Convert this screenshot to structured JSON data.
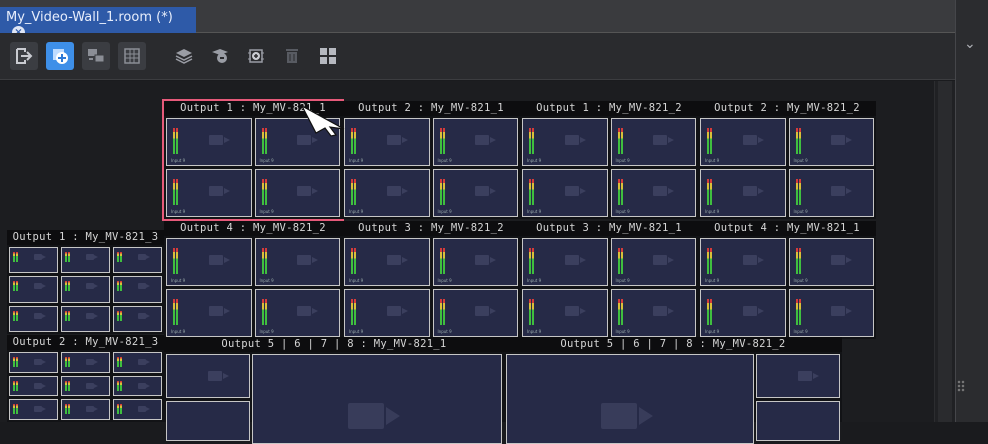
{
  "tab": {
    "title": "My_Video-Wall_1.room (*)",
    "close_glyph": "×"
  },
  "toolbar": {
    "icons": [
      "exit-icon",
      "add-layer-icon",
      "dual-screen-icon",
      "grid-icon",
      "layers-icon",
      "media-icon",
      "add-monitor-icon",
      "trash-icon",
      "tiles-icon"
    ]
  },
  "right_panel": {
    "collapse_glyph": "⌄"
  },
  "colors": {
    "accent": "#2e5aa8",
    "selection": "#e65a7a",
    "cell_bg": "#262a47",
    "meter_green": "#3fbf3f",
    "meter_yellow": "#d9c03a",
    "meter_red": "#d43b3b"
  },
  "cell_label": "Input 9",
  "outputs": [
    {
      "id": "o1",
      "title": "Output 1 : My_MV-821_1"
    },
    {
      "id": "o2",
      "title": "Output 2 : My_MV-821_1"
    },
    {
      "id": "o3",
      "title": "Output 1 : My_MV-821_2"
    },
    {
      "id": "o4",
      "title": "Output 2 : My_MV-821_2"
    },
    {
      "id": "o5",
      "title": "Output 4 : My_MV-821_2"
    },
    {
      "id": "o6",
      "title": "Output 3 : My_MV-821_2"
    },
    {
      "id": "o7",
      "title": "Output 3 : My_MV-821_1"
    },
    {
      "id": "o8",
      "title": "Output 4 : My_MV-821_1"
    },
    {
      "id": "o9",
      "title": "Output 1 : My_MV-821_3"
    },
    {
      "id": "o10",
      "title": "Output 2 : My_MV-821_3"
    },
    {
      "id": "o11",
      "title": "Output 5 | 6 | 7 | 8 : My_MV-821_1"
    },
    {
      "id": "o12",
      "title": "Output 5 | 6 | 7 | 8 : My_MV-821_2"
    }
  ]
}
